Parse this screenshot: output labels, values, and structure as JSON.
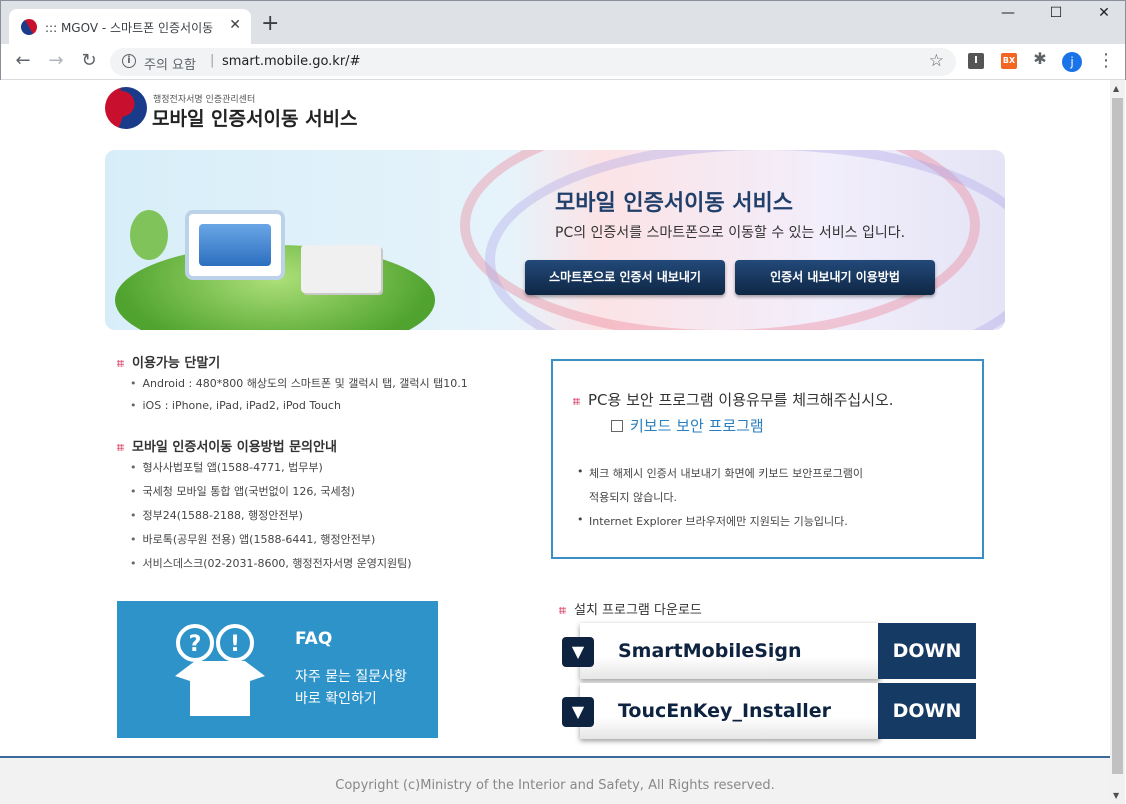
{
  "browser": {
    "tab_title": "::: MGOV - 스마트폰 인증서이동",
    "tab_close": "✕",
    "new_tab": "+",
    "win_min": "—",
    "win_max": "☐",
    "win_close": "✕",
    "security_label": "주의 요함",
    "url": "smart.mobile.go.kr/#",
    "ext1": "I",
    "ext2": "BX",
    "avatar": "j"
  },
  "logo": {
    "sub": "행정전자서명 인증관리센터",
    "main": "모바일 인증서이동 서비스"
  },
  "banner": {
    "title": "모바일 인증서이동 서비스",
    "desc": "PC의 인증서를 스마트폰으로 이동할 수 있는 서비스 입니다.",
    "btn_export": "스마트폰으로 인증서 내보내기",
    "btn_howto": "인증서 내보내기 이용방법"
  },
  "devices": {
    "heading": "이용가능 단말기",
    "items": [
      "Android : 480*800 해상도의 스마트폰 및 갤럭시 탭, 갤럭시 탭10.1",
      "iOS : iPhone, iPad, iPad2, iPod Touch"
    ]
  },
  "inquiry": {
    "heading": "모바일 인증서이동 이용방법 문의안내",
    "items": [
      "형사사법포털 앱(1588-4771, 법무부)",
      "국세청 모바일 통합 앱(국번없이 126, 국세청)",
      "정부24(1588-2188, 행정안전부)",
      "바로톡(공무원 전용) 앱(1588-6441, 행정안전부)",
      "서비스데스크(02-2031-8600, 행정전자서명 운영지원팀)"
    ]
  },
  "security": {
    "heading": "PC용 보안 프로그램 이용유무를 체크해주십시오.",
    "checkbox_label": "키보드 보안 프로그램",
    "note1a": "체크 해제시 인증서 내보내기 화면에 키보드 보안프로그램이",
    "note1b": "적용되지 않습니다.",
    "note2": "Internet Explorer 브라우저에만 지원되는 기능입니다."
  },
  "faq": {
    "title": "FAQ",
    "line1": "자주 묻는 질문사항",
    "line2": "바로 확인하기"
  },
  "downloads": {
    "heading": "설치 프로그램 다운로드",
    "items": [
      {
        "name": "SmartMobileSign",
        "button": "DOWN"
      },
      {
        "name": "ToucEnKey_Installer",
        "button": "DOWN"
      }
    ]
  },
  "footer": {
    "copyright": "Copyright (c)Ministry of the Interior and Safety, All Rights reserved."
  }
}
